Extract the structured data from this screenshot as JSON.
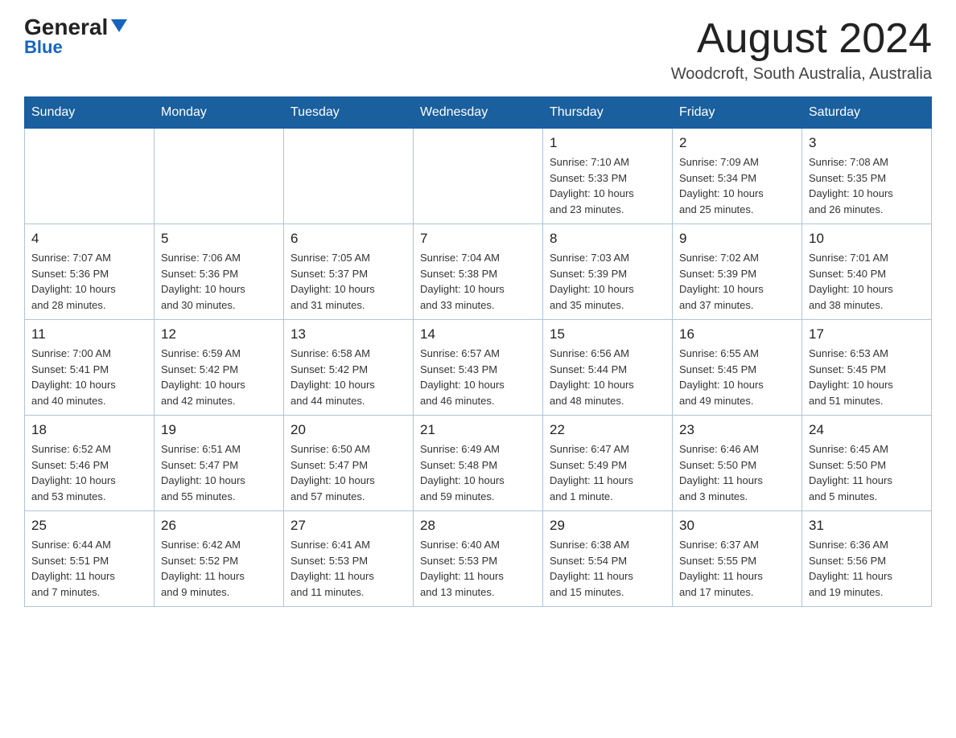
{
  "header": {
    "logo_main": "General",
    "logo_sub": "Blue",
    "title": "August 2024",
    "subtitle": "Woodcroft, South Australia, Australia"
  },
  "days_of_week": [
    "Sunday",
    "Monday",
    "Tuesday",
    "Wednesday",
    "Thursday",
    "Friday",
    "Saturday"
  ],
  "weeks": [
    [
      {
        "day": "",
        "info": ""
      },
      {
        "day": "",
        "info": ""
      },
      {
        "day": "",
        "info": ""
      },
      {
        "day": "",
        "info": ""
      },
      {
        "day": "1",
        "info": "Sunrise: 7:10 AM\nSunset: 5:33 PM\nDaylight: 10 hours\nand 23 minutes."
      },
      {
        "day": "2",
        "info": "Sunrise: 7:09 AM\nSunset: 5:34 PM\nDaylight: 10 hours\nand 25 minutes."
      },
      {
        "day": "3",
        "info": "Sunrise: 7:08 AM\nSunset: 5:35 PM\nDaylight: 10 hours\nand 26 minutes."
      }
    ],
    [
      {
        "day": "4",
        "info": "Sunrise: 7:07 AM\nSunset: 5:36 PM\nDaylight: 10 hours\nand 28 minutes."
      },
      {
        "day": "5",
        "info": "Sunrise: 7:06 AM\nSunset: 5:36 PM\nDaylight: 10 hours\nand 30 minutes."
      },
      {
        "day": "6",
        "info": "Sunrise: 7:05 AM\nSunset: 5:37 PM\nDaylight: 10 hours\nand 31 minutes."
      },
      {
        "day": "7",
        "info": "Sunrise: 7:04 AM\nSunset: 5:38 PM\nDaylight: 10 hours\nand 33 minutes."
      },
      {
        "day": "8",
        "info": "Sunrise: 7:03 AM\nSunset: 5:39 PM\nDaylight: 10 hours\nand 35 minutes."
      },
      {
        "day": "9",
        "info": "Sunrise: 7:02 AM\nSunset: 5:39 PM\nDaylight: 10 hours\nand 37 minutes."
      },
      {
        "day": "10",
        "info": "Sunrise: 7:01 AM\nSunset: 5:40 PM\nDaylight: 10 hours\nand 38 minutes."
      }
    ],
    [
      {
        "day": "11",
        "info": "Sunrise: 7:00 AM\nSunset: 5:41 PM\nDaylight: 10 hours\nand 40 minutes."
      },
      {
        "day": "12",
        "info": "Sunrise: 6:59 AM\nSunset: 5:42 PM\nDaylight: 10 hours\nand 42 minutes."
      },
      {
        "day": "13",
        "info": "Sunrise: 6:58 AM\nSunset: 5:42 PM\nDaylight: 10 hours\nand 44 minutes."
      },
      {
        "day": "14",
        "info": "Sunrise: 6:57 AM\nSunset: 5:43 PM\nDaylight: 10 hours\nand 46 minutes."
      },
      {
        "day": "15",
        "info": "Sunrise: 6:56 AM\nSunset: 5:44 PM\nDaylight: 10 hours\nand 48 minutes."
      },
      {
        "day": "16",
        "info": "Sunrise: 6:55 AM\nSunset: 5:45 PM\nDaylight: 10 hours\nand 49 minutes."
      },
      {
        "day": "17",
        "info": "Sunrise: 6:53 AM\nSunset: 5:45 PM\nDaylight: 10 hours\nand 51 minutes."
      }
    ],
    [
      {
        "day": "18",
        "info": "Sunrise: 6:52 AM\nSunset: 5:46 PM\nDaylight: 10 hours\nand 53 minutes."
      },
      {
        "day": "19",
        "info": "Sunrise: 6:51 AM\nSunset: 5:47 PM\nDaylight: 10 hours\nand 55 minutes."
      },
      {
        "day": "20",
        "info": "Sunrise: 6:50 AM\nSunset: 5:47 PM\nDaylight: 10 hours\nand 57 minutes."
      },
      {
        "day": "21",
        "info": "Sunrise: 6:49 AM\nSunset: 5:48 PM\nDaylight: 10 hours\nand 59 minutes."
      },
      {
        "day": "22",
        "info": "Sunrise: 6:47 AM\nSunset: 5:49 PM\nDaylight: 11 hours\nand 1 minute."
      },
      {
        "day": "23",
        "info": "Sunrise: 6:46 AM\nSunset: 5:50 PM\nDaylight: 11 hours\nand 3 minutes."
      },
      {
        "day": "24",
        "info": "Sunrise: 6:45 AM\nSunset: 5:50 PM\nDaylight: 11 hours\nand 5 minutes."
      }
    ],
    [
      {
        "day": "25",
        "info": "Sunrise: 6:44 AM\nSunset: 5:51 PM\nDaylight: 11 hours\nand 7 minutes."
      },
      {
        "day": "26",
        "info": "Sunrise: 6:42 AM\nSunset: 5:52 PM\nDaylight: 11 hours\nand 9 minutes."
      },
      {
        "day": "27",
        "info": "Sunrise: 6:41 AM\nSunset: 5:53 PM\nDaylight: 11 hours\nand 11 minutes."
      },
      {
        "day": "28",
        "info": "Sunrise: 6:40 AM\nSunset: 5:53 PM\nDaylight: 11 hours\nand 13 minutes."
      },
      {
        "day": "29",
        "info": "Sunrise: 6:38 AM\nSunset: 5:54 PM\nDaylight: 11 hours\nand 15 minutes."
      },
      {
        "day": "30",
        "info": "Sunrise: 6:37 AM\nSunset: 5:55 PM\nDaylight: 11 hours\nand 17 minutes."
      },
      {
        "day": "31",
        "info": "Sunrise: 6:36 AM\nSunset: 5:56 PM\nDaylight: 11 hours\nand 19 minutes."
      }
    ]
  ]
}
